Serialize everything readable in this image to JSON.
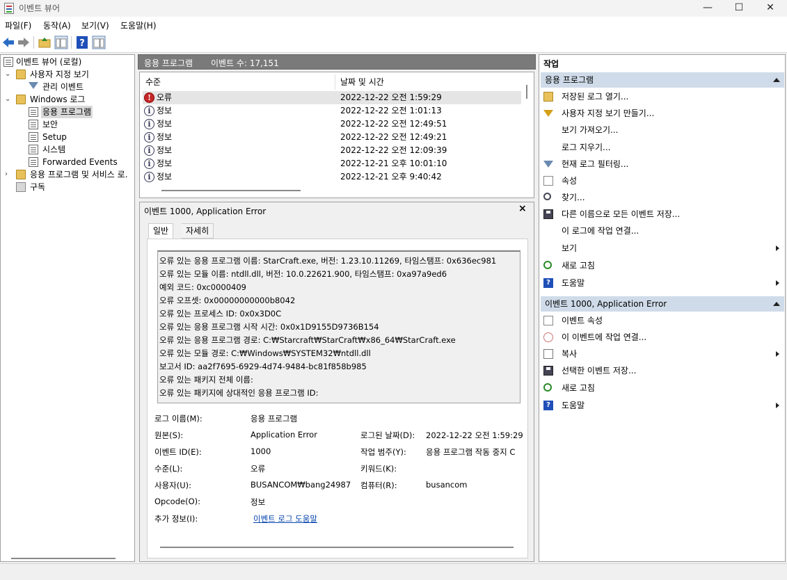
{
  "window": {
    "title": "이벤트 뷰어",
    "minimize": "—",
    "maximize": "☐",
    "close": "✕"
  },
  "menu": [
    "파일(F)",
    "동작(A)",
    "보기(V)",
    "도움말(H)"
  ],
  "tree": {
    "root": "이벤트 뷰어 (로컬)",
    "custom_views": "사용자 지정 보기",
    "admin_events": "관리 이벤트",
    "windows_logs": "Windows 로그",
    "application": "응용 프로그램",
    "security": "보안",
    "setup": "Setup",
    "system": "시스템",
    "forwarded": "Forwarded Events",
    "apps_services": "응용 프로그램 및 서비스 로.",
    "subscriptions": "구독"
  },
  "list_header": {
    "title": "응용 프로그램",
    "count": "이벤트 수: 17,151"
  },
  "columns": {
    "level": "수준",
    "date": "날짜 및 시간"
  },
  "events": [
    {
      "level": "오류",
      "kind": "error",
      "date": "2022-12-22 오전 1:59:29"
    },
    {
      "level": "정보",
      "kind": "info",
      "date": "2022-12-22 오전 1:01:13"
    },
    {
      "level": "정보",
      "kind": "info",
      "date": "2022-12-22 오전 12:49:51"
    },
    {
      "level": "정보",
      "kind": "info",
      "date": "2022-12-22 오전 12:49:21"
    },
    {
      "level": "정보",
      "kind": "info",
      "date": "2022-12-22 오전 12:09:39"
    },
    {
      "level": "정보",
      "kind": "info",
      "date": "2022-12-21 오후 10:01:10"
    },
    {
      "level": "정보",
      "kind": "info",
      "date": "2022-12-21 오후 9:40:42"
    }
  ],
  "detail": {
    "title": "이벤트 1000, Application Error",
    "close": "×",
    "tab_general": "일반",
    "tab_details": "자세히",
    "description": [
      "오류 있는 응용 프로그램 이름: StarCraft.exe, 버전: 1.23.10.11269, 타임스탬프: 0x636ec981",
      "오류 있는 모듈 이름: ntdll.dll, 버전: 10.0.22621.900, 타임스탬프: 0xa97a9ed6",
      "예외 코드: 0xc0000409",
      "오류 오프셋: 0x00000000000b8042",
      "오류 있는 프로세스 ID: 0x0x3D0C",
      "오류 있는 응용 프로그램 시작 시간: 0x0x1D9155D9736B154",
      "오류 있는 응용 프로그램 경로: C:₩Starcraft₩StarCraft₩x86_64₩StarCraft.exe",
      "오류 있는 모듈 경로: C:₩Windows₩SYSTEM32₩ntdll.dll",
      "보고서 ID: aa2f7695-6929-4d74-9484-bc81f858b985",
      "오류 있는 패키지 전체 이름:",
      "오류 있는 패키지에 상대적인 응용 프로그램 ID:"
    ],
    "props": {
      "log_name_label": "로그 이름(M):",
      "log_name": "응용 프로그램",
      "source_label": "원본(S):",
      "source": "Application Error",
      "logged_label": "로그된 날짜(D):",
      "logged": "2022-12-22 오전 1:59:29",
      "event_id_label": "이벤트 ID(E):",
      "event_id": "1000",
      "task_label": "작업 범주(Y):",
      "task": "응용 프로그램 작동 중지 C",
      "level_label": "수준(L):",
      "level": "오류",
      "keywords_label": "키워드(K):",
      "keywords": "",
      "user_label": "사용자(U):",
      "user": "BUSANCOM₩bang24987",
      "computer_label": "컴퓨터(R):",
      "computer": "busancom",
      "opcode_label": "Opcode(O):",
      "opcode": "정보",
      "more_label": "추가 정보(I):",
      "more_link": "이벤트 로그 도움말"
    }
  },
  "actions": {
    "title": "작업",
    "section1": "응용 프로그램",
    "items1": [
      {
        "label": "저장된 로그 열기...",
        "icon": "open-folder-icon"
      },
      {
        "label": "사용자 지정 보기 만들기...",
        "icon": "filter-create-icon"
      },
      {
        "label": "보기 가져오기...",
        "icon": ""
      },
      {
        "label": "로그 지우기...",
        "icon": ""
      },
      {
        "label": "현재 로그 필터링...",
        "icon": "filter-icon"
      },
      {
        "label": "속성",
        "icon": "properties-icon"
      },
      {
        "label": "찾기...",
        "icon": "find-icon"
      },
      {
        "label": "다른 이름으로 모든 이벤트 저장...",
        "icon": "save-icon"
      },
      {
        "label": "이 로그에 작업 연결...",
        "icon": ""
      },
      {
        "label": "보기",
        "icon": "",
        "submenu": true
      },
      {
        "label": "새로 고침",
        "icon": "refresh-icon"
      },
      {
        "label": "도움말",
        "icon": "help-icon",
        "submenu": true
      }
    ],
    "section2": "이벤트 1000, Application Error",
    "items2": [
      {
        "label": "이벤트 속성",
        "icon": "properties-icon"
      },
      {
        "label": "이 이벤트에 작업 연결...",
        "icon": "attach-task-icon"
      },
      {
        "label": "복사",
        "icon": "copy-icon",
        "submenu": true
      },
      {
        "label": "선택한 이벤트 저장...",
        "icon": "save-icon"
      },
      {
        "label": "새로 고침",
        "icon": "refresh-icon"
      },
      {
        "label": "도움말",
        "icon": "help-icon",
        "submenu": true
      }
    ]
  }
}
